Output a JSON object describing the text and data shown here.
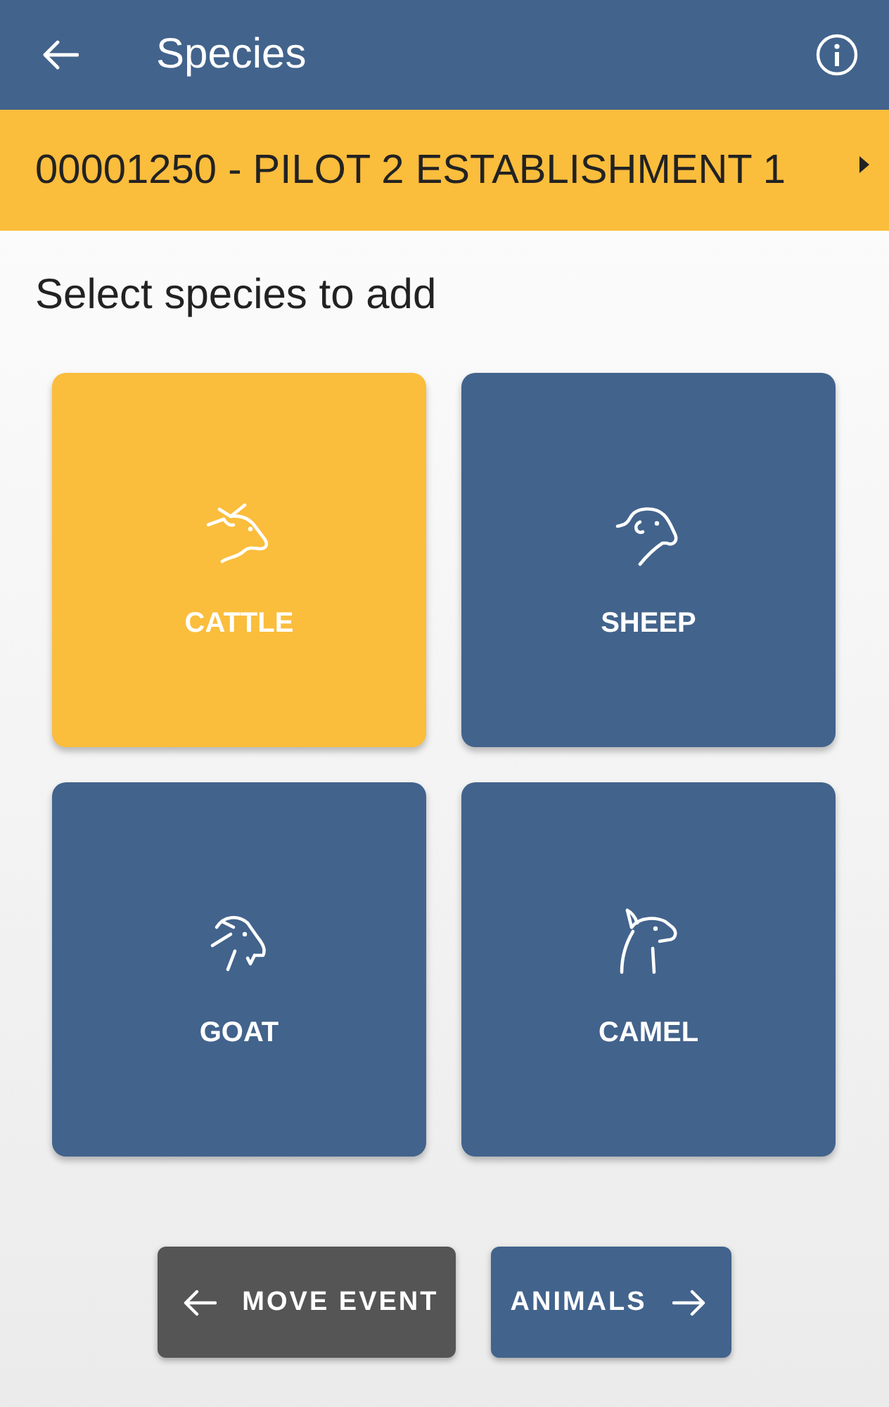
{
  "app_bar": {
    "title": "Species"
  },
  "establishment": {
    "label": "00001250 - PILOT 2 ESTABLISHMENT 1"
  },
  "heading": "Select species to add",
  "species": [
    {
      "kind": "cattle",
      "label": "CATTLE",
      "selected": true
    },
    {
      "kind": "sheep",
      "label": "SHEEP",
      "selected": false
    },
    {
      "kind": "goat",
      "label": "GOAT",
      "selected": false
    },
    {
      "kind": "camel",
      "label": "CAMEL",
      "selected": false
    }
  ],
  "footer": {
    "back": {
      "label": "MOVE EVENT"
    },
    "next": {
      "label": "ANIMALS"
    }
  }
}
